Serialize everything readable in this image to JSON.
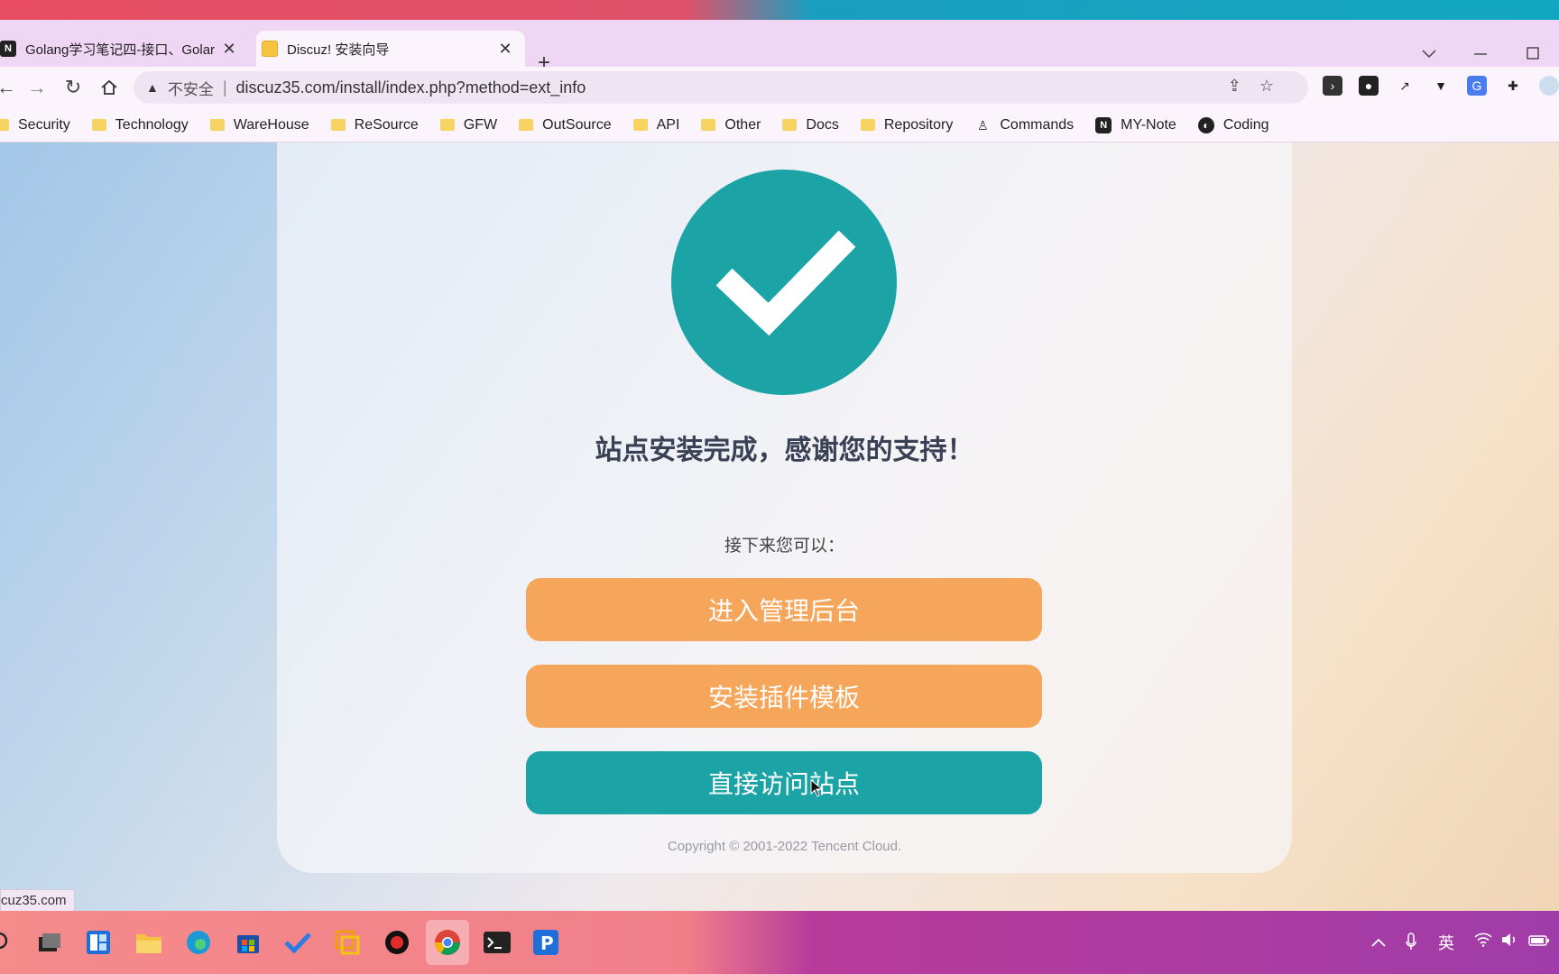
{
  "browser": {
    "tabs": [
      {
        "title": "Golang学习笔记四-接口、Golar",
        "close": "✕",
        "favicon": "notion-icon"
      },
      {
        "title": "Discuz! 安装向导",
        "close": "✕",
        "favicon": "discuz-icon"
      }
    ],
    "new_tab": "+",
    "omnibox": {
      "security_label": "不安全",
      "separator": "|",
      "url": "discuz35.com/install/index.php?method=ext_info"
    },
    "bookmarks": [
      {
        "label": "Security"
      },
      {
        "label": "Technology"
      },
      {
        "label": "WareHouse"
      },
      {
        "label": "ReSource"
      },
      {
        "label": "GFW"
      },
      {
        "label": "OutSource"
      },
      {
        "label": "API"
      },
      {
        "label": "Other"
      },
      {
        "label": "Docs"
      },
      {
        "label": "Repository"
      },
      {
        "label": "Commands"
      },
      {
        "label": "MY-Note"
      },
      {
        "label": "Coding"
      }
    ],
    "status_url": "cuz35.com"
  },
  "page": {
    "headline": "站点安装完成，感谢您的支持！",
    "next_text": "接下来您可以：",
    "buttons": {
      "admin": "进入管理后台",
      "plugin": "安装插件模板",
      "visit": "直接访问站点"
    },
    "copyright": "Copyright © 2001-2022 Tencent Cloud."
  },
  "taskbar": {
    "ime_label": "英"
  },
  "colors": {
    "teal": "#1ba3a6",
    "orange": "#f6a65a"
  }
}
